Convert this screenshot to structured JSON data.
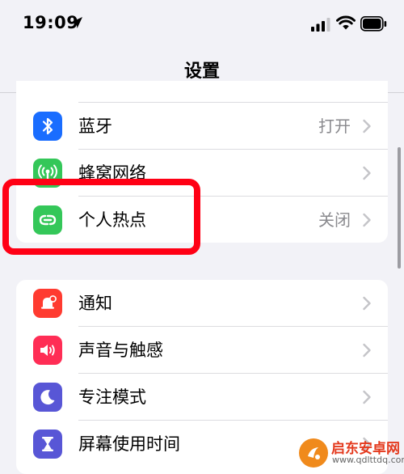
{
  "status_bar": {
    "time": "19:09",
    "icons": [
      "location-arrow-icon",
      "cellular-signal-icon",
      "wifi-icon",
      "battery-icon"
    ]
  },
  "nav": {
    "title": "设置"
  },
  "groups": [
    {
      "items": [
        {
          "label": "蓝牙",
          "value": "打开",
          "icon": "bluetooth-icon",
          "color": "#1a6dff"
        },
        {
          "label": "蜂窝网络",
          "value": "",
          "icon": "cellular-antenna-icon",
          "color": "#34c759"
        },
        {
          "label": "个人热点",
          "value": "关闭",
          "icon": "personal-hotspot-icon",
          "color": "#34c759"
        }
      ]
    },
    {
      "items": [
        {
          "label": "通知",
          "value": "",
          "icon": "notification-bell-icon",
          "color": "#ff3b30"
        },
        {
          "label": "声音与触感",
          "value": "",
          "icon": "speaker-icon",
          "color": "#ff2d55"
        },
        {
          "label": "专注模式",
          "value": "",
          "icon": "moon-icon",
          "color": "#5856d6"
        },
        {
          "label": "屏幕使用时间",
          "value": "",
          "icon": "hourglass-icon",
          "color": "#5856d6"
        }
      ]
    }
  ],
  "annotation": {
    "highlight_color": "#ff0015"
  },
  "watermark": {
    "text": "启东安卓网",
    "url": "www.qdlttdq.com",
    "logo_color": "#f08a1c"
  }
}
